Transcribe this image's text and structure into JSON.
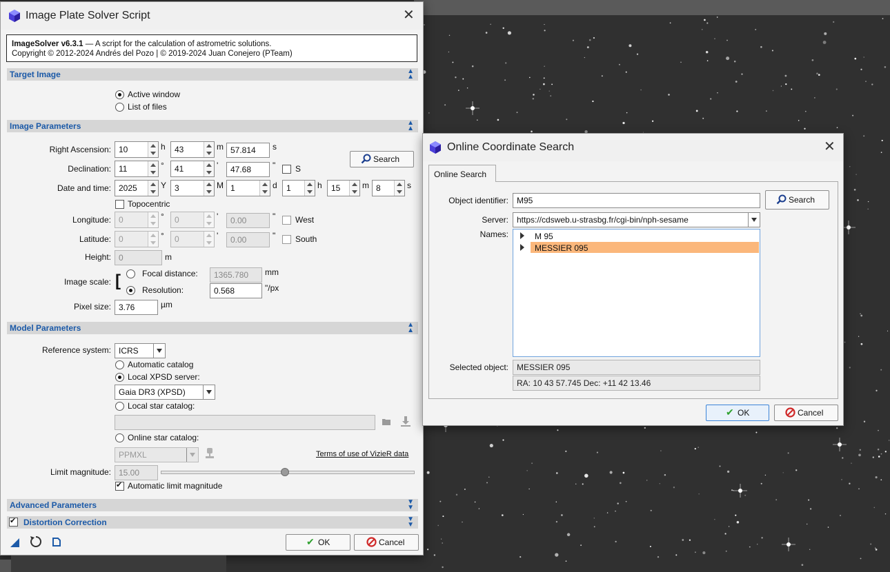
{
  "colors": {
    "section_title": "#1c5aa8",
    "selection": "#fbb77b",
    "focus_border": "#3b84d8"
  },
  "main": {
    "title": "Image Plate Solver Script",
    "header": {
      "name": "ImageSolver v6.3.1",
      "desc": " — A script for the calculation of astrometric solutions.",
      "copyright": "Copyright © 2012-2024 Andrés del Pozo | © 2019-2024 Juan Conejero (PTeam)"
    },
    "target": {
      "title": "Target Image",
      "active_window": "Active window",
      "list_of_files": "List of files"
    },
    "image_params": {
      "title": "Image Parameters",
      "ra_label": "Right Ascension:",
      "ra": [
        "10",
        "43",
        "57.814"
      ],
      "ra_units": [
        "h",
        "m",
        "s"
      ],
      "dec_label": "Declination:",
      "dec": [
        "11",
        "41",
        "47.68"
      ],
      "dec_units": [
        "°",
        "'",
        "\""
      ],
      "south_label": "S",
      "search_label": "Search",
      "date_label": "Date and time:",
      "date": [
        "2025",
        "3",
        "1",
        "1",
        "15",
        "8"
      ],
      "date_units": [
        "Y",
        "M",
        "d",
        "h",
        "m",
        "s"
      ],
      "topocentric": "Topocentric",
      "lon_label": "Longitude:",
      "lon": [
        "0",
        "0",
        "0.00"
      ],
      "west": "West",
      "lat_label": "Latitude:",
      "lat": [
        "0",
        "0",
        "0.00"
      ],
      "south": "South",
      "height_label": "Height:",
      "height": "0",
      "height_unit": "m",
      "scale_label": "Image scale:",
      "focal_label": "Focal distance:",
      "focal": "1365.780",
      "focal_unit": "mm",
      "res_label": "Resolution:",
      "res": "0.568",
      "res_unit": "\"/px",
      "pixel_label": "Pixel size:",
      "pixel": "3.76",
      "pixel_unit": "µm"
    },
    "model": {
      "title": "Model Parameters",
      "ref_label": "Reference system:",
      "ref": "ICRS",
      "auto_catalog": "Automatic catalog",
      "local_xpsd": "Local XPSD server:",
      "xpsd_value": "Gaia DR3 (XPSD)",
      "local_star": "Local star catalog:",
      "online_star": "Online star catalog:",
      "online_value": "PPMXL",
      "vizier_link": "Terms of use of VizieR data",
      "limit_label": "Limit magnitude:",
      "limit": "15.00",
      "limit_fraction": 0.49,
      "auto_limit": "Automatic limit magnitude"
    },
    "advanced": {
      "title": "Advanced Parameters"
    },
    "distortion": {
      "title": "Distortion Correction"
    },
    "ok": "OK",
    "cancel": "Cancel"
  },
  "search_dialog": {
    "title": "Online Coordinate Search",
    "tab": "Online Search",
    "object_label": "Object identifier:",
    "object": "M95",
    "search": "Search",
    "server_label": "Server:",
    "server": "https://cdsweb.u-strasbg.fr/cgi-bin/nph-sesame",
    "names_label": "Names:",
    "names": [
      "M 95",
      "MESSIER 095"
    ],
    "selected_label": "Selected object:",
    "selected": "MESSIER 095",
    "coords": "RA: 10 43 57.745  Dec: +11 42 13.46",
    "ok": "OK",
    "cancel": "Cancel"
  }
}
